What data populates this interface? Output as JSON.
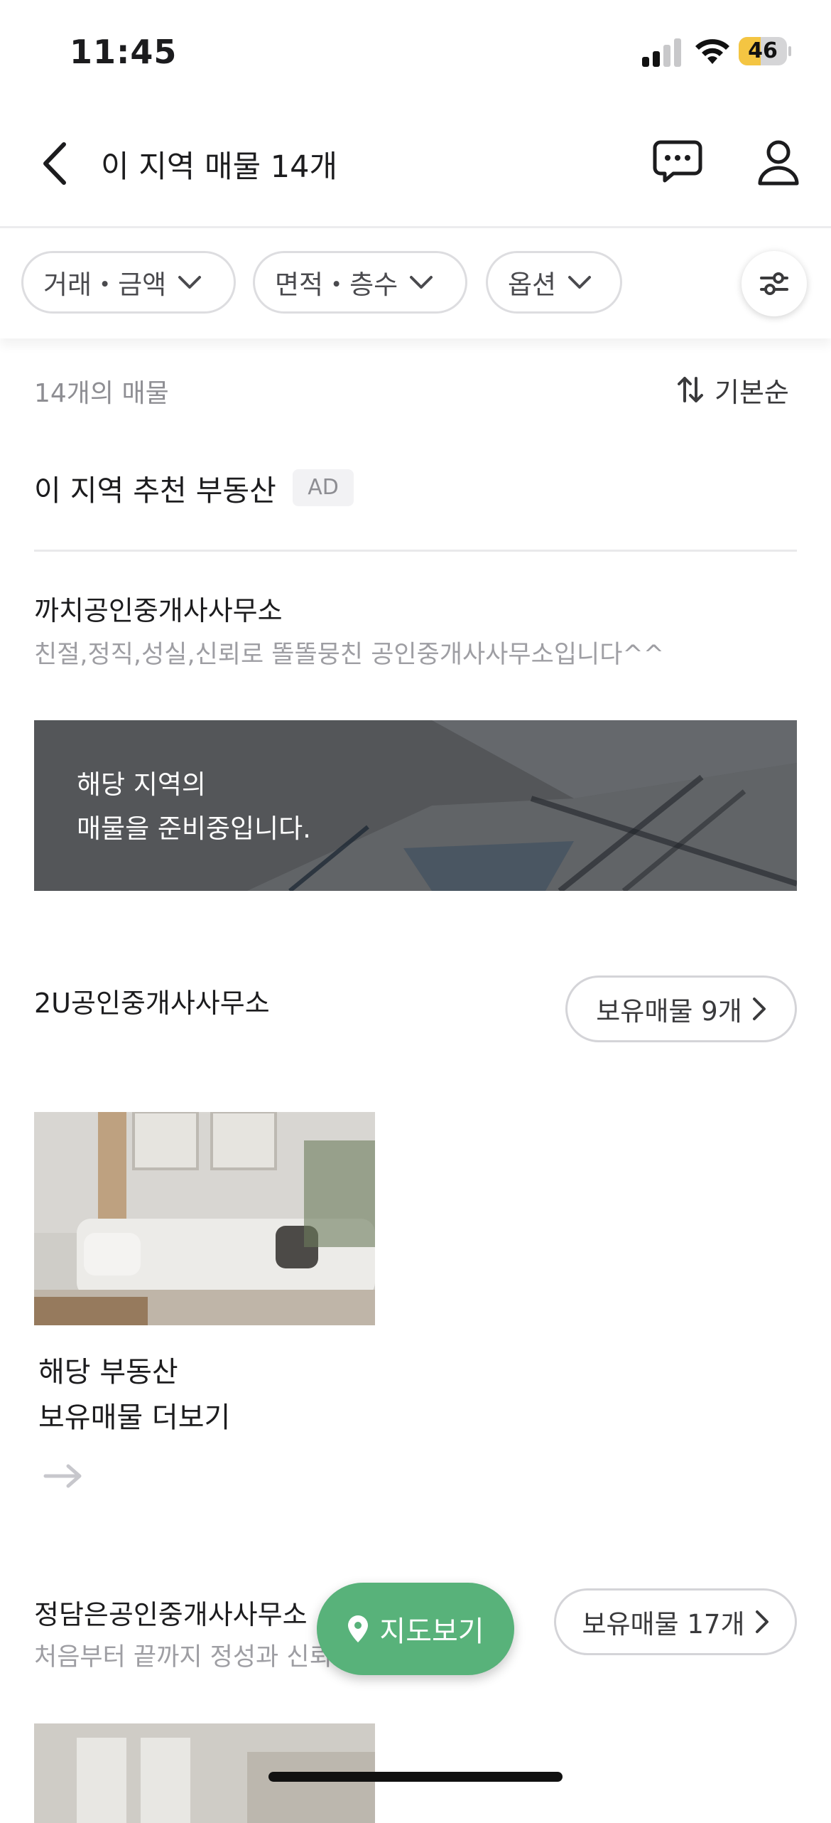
{
  "status_bar": {
    "time": "11:45",
    "battery": "46",
    "battery_percent": 46,
    "battery_color": "#f4c542"
  },
  "header": {
    "title": "이 지역 매물 14개",
    "back_icon": "chevron-left-icon",
    "chat_icon": "chat-bubble-icon",
    "profile_icon": "person-icon"
  },
  "filters": {
    "chips": [
      {
        "label": "거래・금액"
      },
      {
        "label": "면적・층수"
      },
      {
        "label": "옵션"
      }
    ],
    "settings_icon": "sliders-icon"
  },
  "list_meta": {
    "count": "14개의 매물",
    "sort_label": "기본순"
  },
  "recommend": {
    "title": "이 지역 추천 부동산",
    "ad_badge": "AD"
  },
  "agencies": [
    {
      "name": "까치공인중개사사무소",
      "description": "친절,정직,성실,신뢰로 똘똘뭉친 공인중개사사무소입니다^^",
      "banner_text": "해당 지역의\n매물을 준비중입니다."
    },
    {
      "name": "2U공인중개사사무소",
      "holdings_button": "보유매물 9개",
      "more_text": "해당 부동산\n보유매물 더보기"
    },
    {
      "name": "정담은공인중개사사무소",
      "description": "처음부터 끝까지 정성과 신뢰로 함께합니다.",
      "holdings_button": "보유매물 17개"
    }
  ],
  "map_button": {
    "label": "지도보기",
    "color": "#58b27a"
  },
  "colors": {
    "accent_green": "#58b27a"
  }
}
